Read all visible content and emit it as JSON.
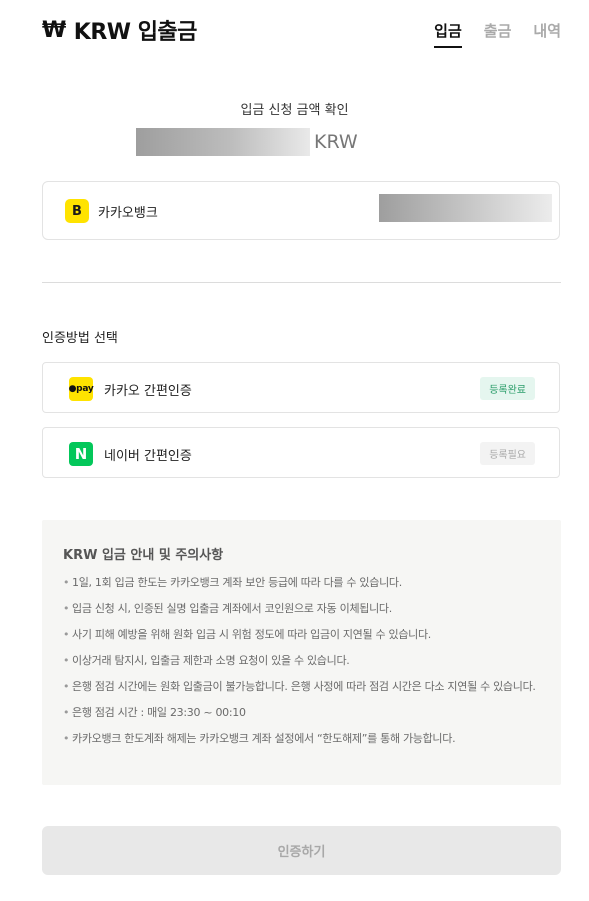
{
  "header": {
    "currency_symbol": "₩",
    "title": "KRW 입출금",
    "tabs": [
      {
        "label": "입금",
        "active": true
      },
      {
        "label": "출금",
        "active": false
      },
      {
        "label": "내역",
        "active": false
      }
    ]
  },
  "confirm": {
    "label": "입금 신청 금액 확인",
    "amount_unit": "KRW"
  },
  "bank": {
    "logo_letter": "B",
    "name": "카카오뱅크"
  },
  "auth": {
    "title": "인증방법 선택",
    "methods": [
      {
        "logo_text": "●pay",
        "name": "카카오 간편인증",
        "status": "등록완료"
      },
      {
        "logo_text": "N",
        "name": "네이버 간편인증",
        "status": "등록필요"
      }
    ]
  },
  "notice": {
    "title": "KRW 입금 안내 및 주의사항",
    "bullet": "•",
    "items": [
      "1일, 1회 입금 한도는 카카오뱅크 계좌 보안 등급에 따라 다를 수 있습니다.",
      "입금 신청 시, 인증된 실명 입출금 계좌에서 코인원으로 자동 이체됩니다.",
      "사기 피해 예방을 위해 원화 입금 시 위험 정도에 따라 입금이 지연될 수 있습니다.",
      "이상거래 탐지시, 입출금 제한과 소명 요청이 있을 수 있습니다.",
      "은행 점검 시간에는 원화 입출금이 불가능합니다. 은행 사정에 따라 점검 시간은 다소 지연될 수 있습니다.",
      "은행 점검 시간 : 매일 23:30 ~ 00:10",
      "카카오뱅크 한도계좌 해제는 카카오뱅크 계좌 설정에서 “한도해제”를 통해 가능합니다."
    ]
  },
  "submit_label": "인증하기",
  "colors": {
    "kakao_yellow": "#ffe300",
    "naver_green": "#03c75a",
    "badge_done_bg": "#e5f6ef",
    "badge_done_text": "#2a9d6a"
  }
}
